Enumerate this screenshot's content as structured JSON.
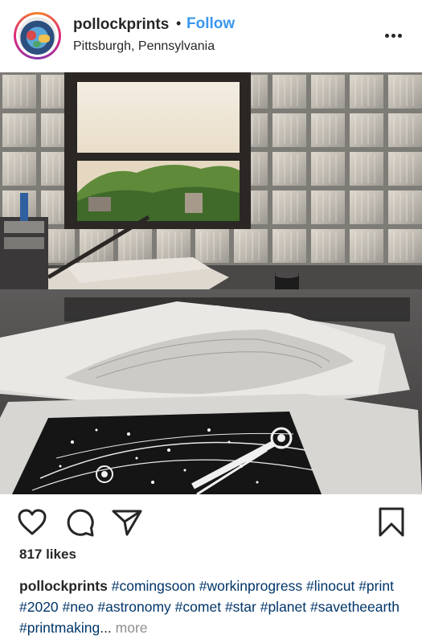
{
  "post": {
    "username": "pollockprints",
    "separator": "•",
    "follow_label": "Follow",
    "location": "Pittsburgh, Pennsylvania",
    "likes": "817 likes",
    "caption": {
      "user": "pollockprints",
      "hashtags": [
        "#comingsoon",
        "#workinprogress",
        "#linocut",
        "#print",
        "#2020",
        "#neo",
        "#astronomy",
        "#comet",
        "#star",
        "#planet",
        "#savetheearth"
      ],
      "truncated_tag": "#printmaking",
      "ellipsis": "...",
      "more_label": "more"
    }
  },
  "icons": {
    "options": "more-options-icon",
    "like": "heart-icon",
    "comment": "comment-icon",
    "share": "send-icon",
    "save": "bookmark-icon"
  },
  "colors": {
    "follow": "#3897f0",
    "hashtag": "#003569",
    "more": "#8e8e8e",
    "text": "#262626"
  }
}
